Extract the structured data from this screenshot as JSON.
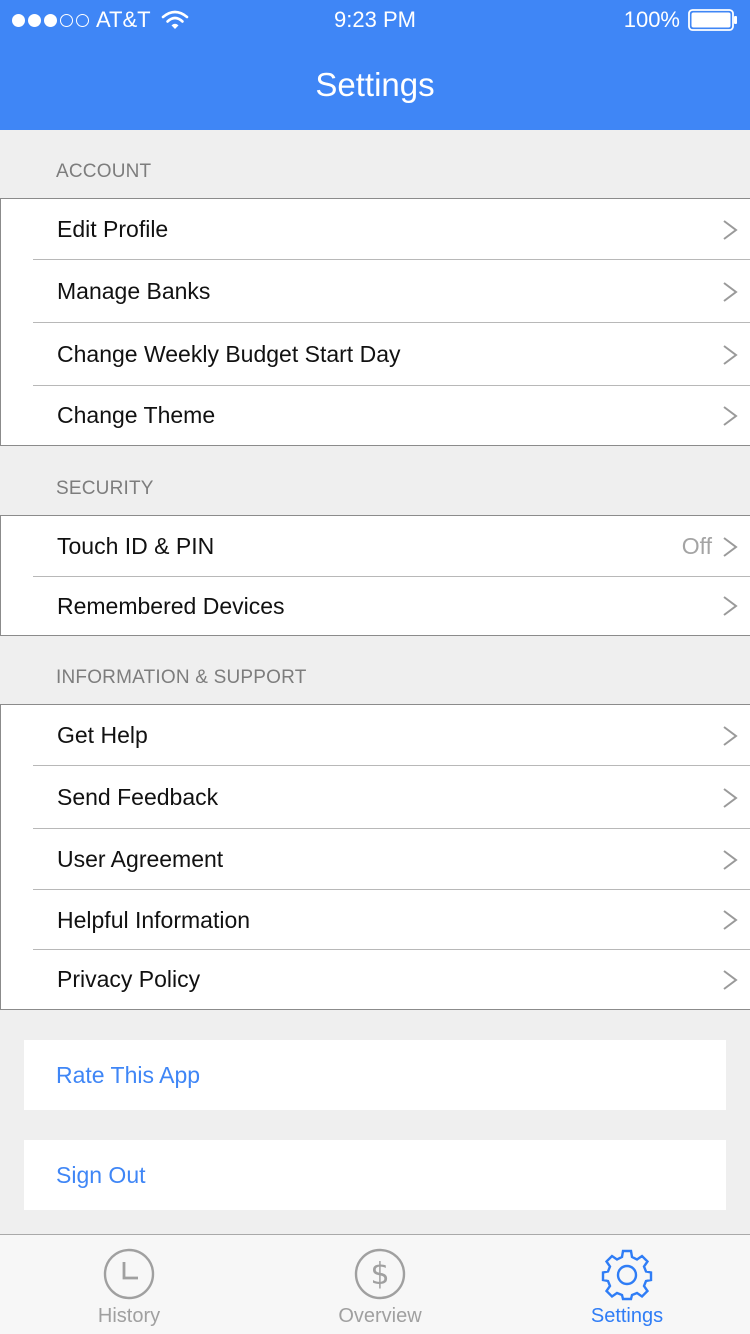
{
  "status_bar": {
    "carrier": "AT&T",
    "time": "9:23 PM",
    "battery": "100%"
  },
  "nav": {
    "title": "Settings"
  },
  "sections": {
    "account": {
      "header": "ACCOUNT",
      "items": [
        {
          "label": "Edit Profile"
        },
        {
          "label": "Manage Banks"
        },
        {
          "label": "Change Weekly Budget Start Day"
        },
        {
          "label": "Change Theme"
        }
      ]
    },
    "security": {
      "header": "SECURITY",
      "items": [
        {
          "label": "Touch ID & PIN",
          "value": "Off"
        },
        {
          "label": "Remembered Devices"
        }
      ]
    },
    "info": {
      "header": "INFORMATION & SUPPORT",
      "items": [
        {
          "label": "Get Help"
        },
        {
          "label": "Send Feedback"
        },
        {
          "label": "User Agreement"
        },
        {
          "label": "Helpful Information"
        },
        {
          "label": "Privacy Policy"
        }
      ]
    }
  },
  "actions": {
    "rate": "Rate This App",
    "signout": "Sign Out"
  },
  "tabbar": {
    "tabs": [
      {
        "label": "History",
        "icon": "clock-icon"
      },
      {
        "label": "Overview",
        "icon": "dollar-icon"
      },
      {
        "label": "Settings",
        "icon": "gear-icon",
        "active": true
      }
    ]
  },
  "colors": {
    "accent": "#3f86f6",
    "background": "#efefef",
    "secondary_text": "#7d7d7d"
  }
}
